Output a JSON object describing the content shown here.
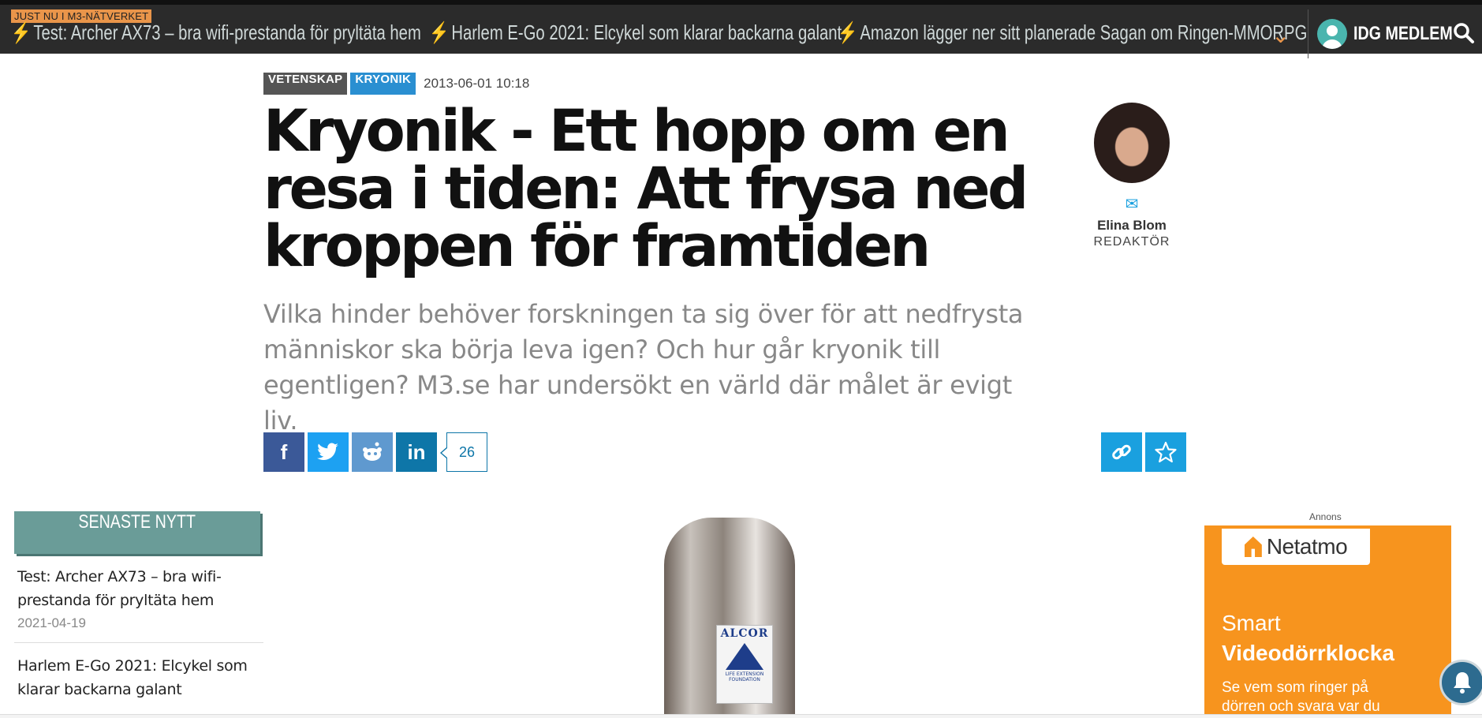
{
  "topbar": {
    "just_now": "JUST NU I M3-NÄTVERKET",
    "ticker": [
      "Test: Archer AX73 – bra wifi-prestanda för pryltäta hem",
      "Harlem E-Go 2021: Elcykel som klarar backarna galant",
      "Amazon lägger ner sitt planerade Sagan om Ringen-MMORPG"
    ],
    "member_label": "IDG MEDLEM"
  },
  "article": {
    "tags": [
      "VETENSKAP",
      "KRYONIK"
    ],
    "date": "2013-06-01 10:18",
    "title": "Kryonik - Ett hopp om en resa i tiden: Att frysa ned kroppen för framtiden",
    "lead": "Vilka hinder behöver forskningen ta sig över för att nedfrysta människor ska börja leva igen? Och hur går kryonik till egentligen? M3.se har undersökt en värld där målet är evigt liv.",
    "share_count": "26"
  },
  "author": {
    "name": "Elina Blom",
    "role": "REDAKTÖR"
  },
  "sidebar": {
    "heading": "SENASTE NYTT",
    "items": [
      {
        "title": "Test: Archer AX73 – bra wifi-prestanda för pryltäta hem",
        "date": "2021-04-19"
      },
      {
        "title": "Harlem E-Go 2021: Elcykel som klarar backarna galant",
        "date": ""
      }
    ]
  },
  "image": {
    "logo_text": "ALCOR",
    "logo_sub": "LIFE EXTENSION FOUNDATION"
  },
  "ad": {
    "label": "Annons",
    "brand": "Netatmo",
    "line1": "Smart",
    "line2": "Videodörrklocka",
    "line3": "Se vem som ringer på dörren och svara var du"
  },
  "colors": {
    "accent": "#e9954a",
    "topbar": "#2b2b2b",
    "facebook": "#3b5998",
    "twitter": "#1da1f2",
    "reddit": "#5f99cf",
    "linkedin": "#0e76a8",
    "ad": "#f7941e"
  }
}
